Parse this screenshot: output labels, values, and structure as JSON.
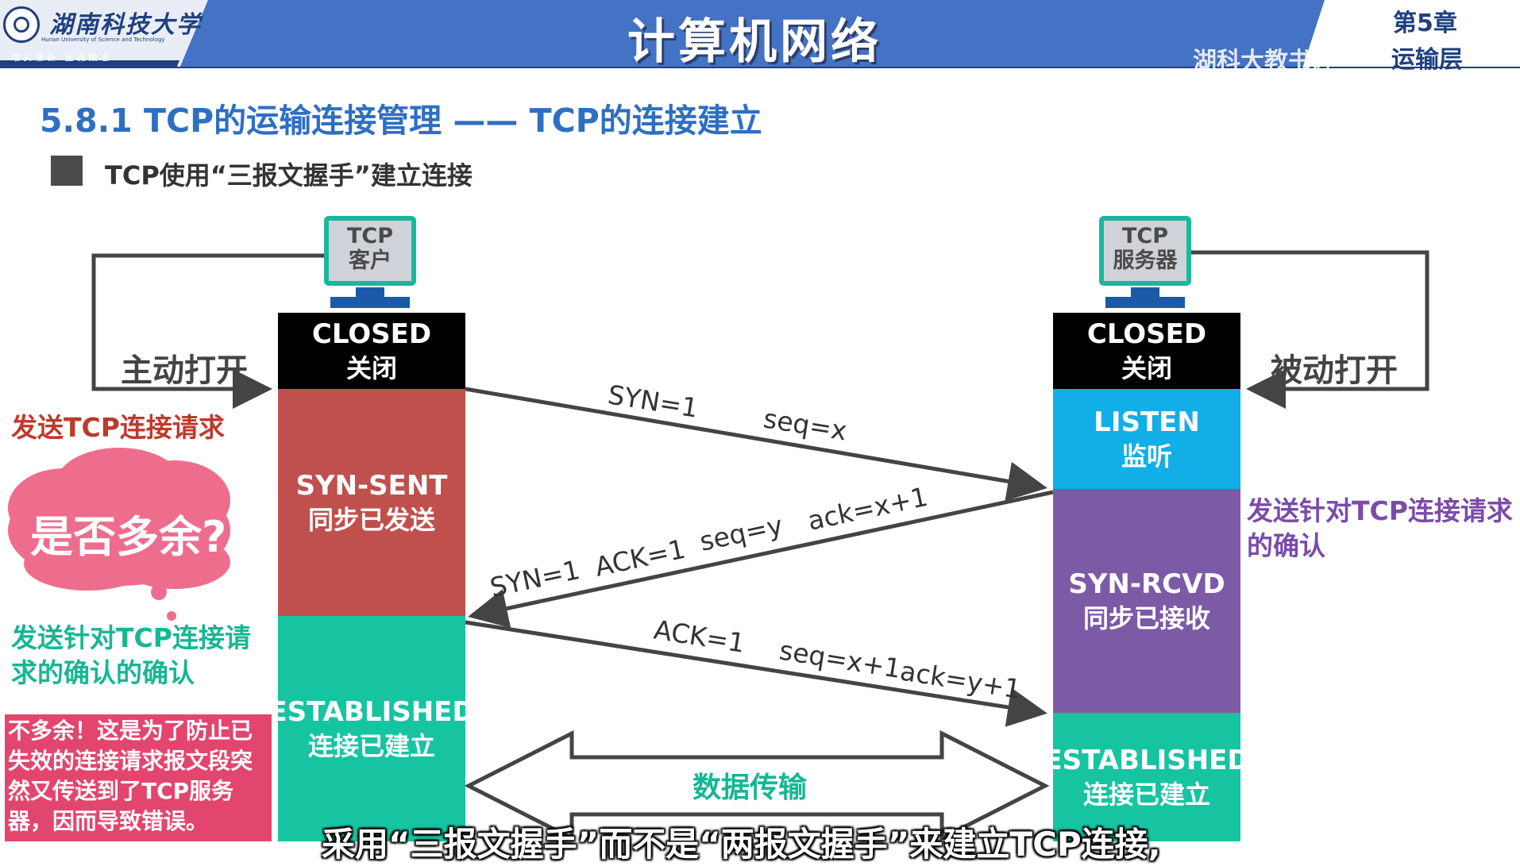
{
  "header": {
    "university_name": "湖南科技大学",
    "university_name_en": "Hunan University of Science and Technology",
    "motto": "唯实惟新  至诚致志",
    "course_title": "计算机网络",
    "chapter": "第5章",
    "chapter_sub": "运输层",
    "watermark": "湖科大教书匠"
  },
  "section": {
    "title": "5.8.1 TCP的运输连接管理 —— TCP的连接建立",
    "bullet": "TCP使用“三报文握手”建立连接"
  },
  "client": {
    "pc_label_line1": "TCP",
    "pc_label_line2": "客户",
    "open_label": "主动打开",
    "states": [
      {
        "en": "CLOSED",
        "cn": "关闭",
        "color": "#000000"
      },
      {
        "en": "SYN-SENT",
        "cn": "同步已发送",
        "color": "#c0504d"
      },
      {
        "en": "ESTABLISHED",
        "cn": "连接已建立",
        "color": "#16c4a2"
      }
    ]
  },
  "server": {
    "pc_label_line1": "TCP",
    "pc_label_line2": "服务器",
    "open_label": "被动打开",
    "states": [
      {
        "en": "CLOSED",
        "cn": "关闭",
        "color": "#000000"
      },
      {
        "en": "LISTEN",
        "cn": "监听",
        "color": "#12aee8"
      },
      {
        "en": "SYN-RCVD",
        "cn": "同步已接收",
        "color": "#7c5aa6"
      },
      {
        "en": "ESTABLISHED",
        "cn": "连接已建立",
        "color": "#16c4a2"
      }
    ]
  },
  "segments": {
    "syn": {
      "flag": "SYN=1",
      "seq": "seq=x"
    },
    "synack": {
      "syn": "SYN=1",
      "ack_flag": "ACK=1",
      "seq": "seq=y",
      "ack": "ack=x+1"
    },
    "ack": {
      "ack_flag": "ACK=1",
      "seq": "seq=x+1",
      "ack": "ack=y+1"
    }
  },
  "data_transfer_label": "数据传输",
  "annotations": {
    "send_request": "发送TCP连接请求",
    "send_ack_line1": "发送针对TCP连接请求",
    "send_ack_line2": "的确认",
    "ack_of_ack_line1": "发送针对TCP连接请",
    "ack_of_ack_line2": "求的确认的确认",
    "cloud_question": "是否多余?",
    "note_lines": [
      "不多余！这是为了防止已",
      "失效的连接请求报文段突",
      "然又传送到了TCP服务",
      "器，因而导致错误。"
    ]
  },
  "subtitle": "采用“三报文握手”而不是“两报文握手”来建立TCP连接,",
  "colors": {
    "header_blue": "#4472c4",
    "title_blue": "#2e6fc2",
    "teal": "#16c4a2",
    "red": "#c0504d",
    "purple": "#7c5aa6",
    "listen_blue": "#12aee8",
    "pink_cloud": "#ee6d8d"
  }
}
